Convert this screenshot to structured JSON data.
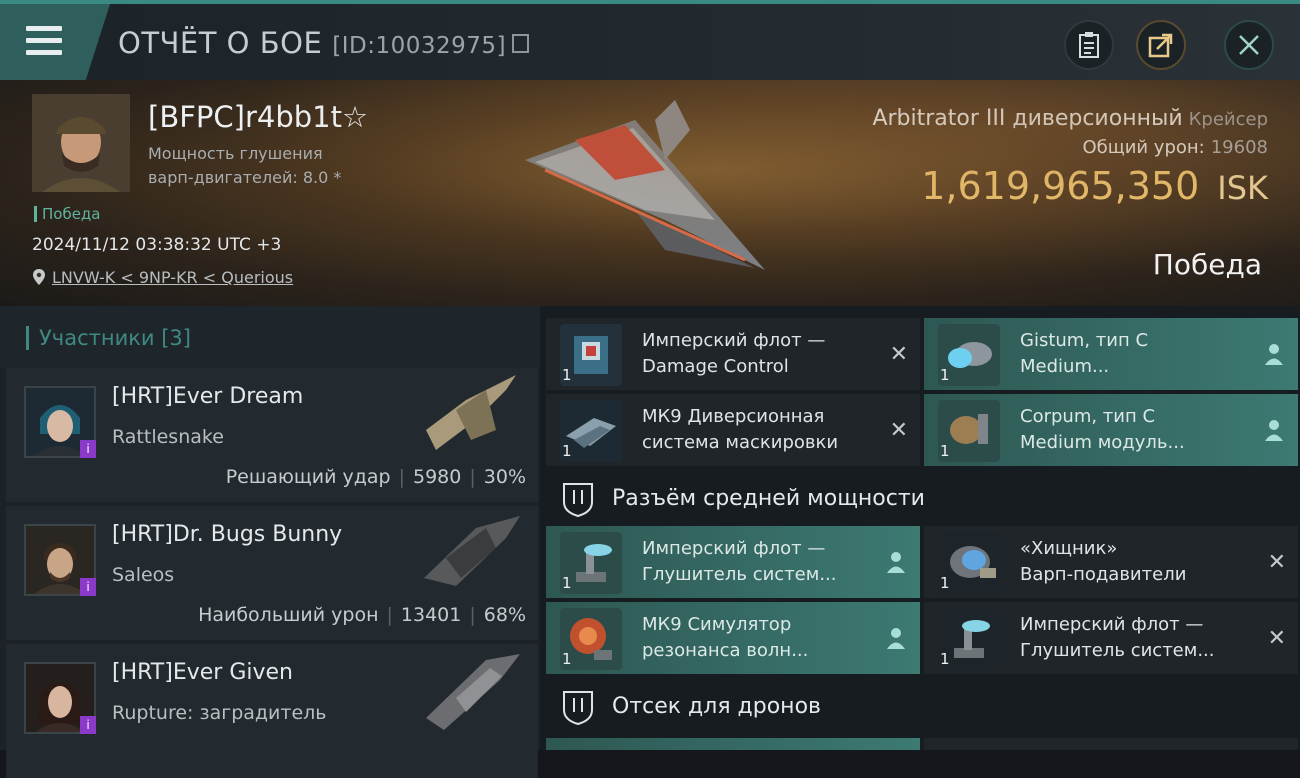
{
  "header": {
    "title": "ОТЧЁТ О БОЕ",
    "report_id": "[ID:10032975]",
    "buttons": [
      "clipboard-icon",
      "share-icon",
      "close-icon"
    ]
  },
  "victim": {
    "name": "[BFPC]r4bb1t☆",
    "stat_line1": "Мощность глушения",
    "stat_line2": "варп-двигателей: 8.0 *",
    "status_tag": "Победа",
    "datetime": "2024/11/12 03:38:32 UTC +3",
    "location": "LNVW-K < 9NP-KR < Querious",
    "ship_name": "Arbitrator III диверсионный",
    "ship_class": "Крейсер",
    "damage_label": "Общий урон:",
    "damage_value": "19608",
    "isk_value": "1,619,965,350",
    "isk_unit": "ISK",
    "outcome": "Победа"
  },
  "participants": {
    "header": "Участники [3]",
    "items": [
      {
        "name": "[HRT]Ever Dream",
        "ship": "Rattlesnake",
        "stat_label": "Решающий удар",
        "damage": "5980",
        "percent": "30%"
      },
      {
        "name": "[HRT]Dr. Bugs Bunny",
        "ship": "Saleos",
        "stat_label": "Наибольший урон",
        "damage": "13401",
        "percent": "68%"
      },
      {
        "name": "[HRT]Ever Given",
        "ship": "Rupture: заградитель",
        "stat_label": "",
        "damage": "",
        "percent": ""
      }
    ]
  },
  "fittings": {
    "low_slots": [
      {
        "qty": "1",
        "line1": "Имперский флот —",
        "line2": "Damage Control",
        "state": "destroyed"
      },
      {
        "qty": "1",
        "line1": "Gistum, тип C",
        "line2": "Medium...",
        "state": "dropped"
      },
      {
        "qty": "1",
        "line1": "МК9 Диверсионная",
        "line2": "система маскировки",
        "state": "destroyed"
      },
      {
        "qty": "1",
        "line1": "Corpum, тип C",
        "line2": "Medium модуль...",
        "state": "dropped"
      }
    ],
    "mid_section_label": "Разъём средней мощности",
    "mid_slots": [
      {
        "qty": "1",
        "line1": "Имперский флот —",
        "line2": "Глушитель систем...",
        "state": "dropped"
      },
      {
        "qty": "1",
        "line1": "«Хищник»",
        "line2": "Варп-подавители",
        "state": "destroyed"
      },
      {
        "qty": "1",
        "line1": "МК9 Симулятор",
        "line2": "резонанса волн...",
        "state": "dropped"
      },
      {
        "qty": "1",
        "line1": "Имперский флот —",
        "line2": "Глушитель систем...",
        "state": "destroyed"
      }
    ],
    "drone_section_label": "Отсек для дронов",
    "destroyed_mark": "✕"
  }
}
